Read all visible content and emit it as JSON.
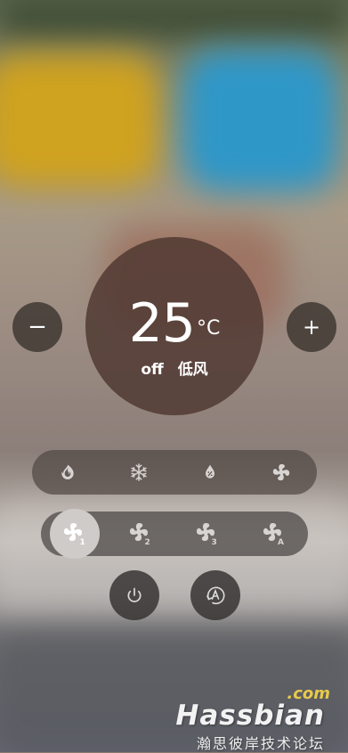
{
  "thermostat": {
    "temperature": "25",
    "unit": "°C",
    "state": "off",
    "fan_speed_label": "低风",
    "decrease_label": "−",
    "increase_label": "+"
  },
  "modes": [
    {
      "icon": "flame-icon"
    },
    {
      "icon": "snowflake-icon"
    },
    {
      "icon": "water-drop-icon"
    },
    {
      "icon": "fan-icon"
    }
  ],
  "fan_speeds": [
    {
      "icon": "fan-icon",
      "badge": "1",
      "active": true
    },
    {
      "icon": "fan-icon",
      "badge": "2",
      "active": false
    },
    {
      "icon": "fan-icon",
      "badge": "3",
      "active": false
    },
    {
      "icon": "fan-icon",
      "badge": "A",
      "active": false
    }
  ],
  "actions": [
    {
      "icon": "power-icon"
    },
    {
      "icon": "auto-mode-icon"
    }
  ],
  "watermark": {
    "domain": ".com",
    "brand": "Hassbian",
    "subtitle": "瀚思彼岸技术论坛"
  },
  "colors": {
    "active_fan_bg": "#cfcbc8",
    "dial_bg": "#503a32",
    "watermark_accent": "#e8c94a"
  }
}
